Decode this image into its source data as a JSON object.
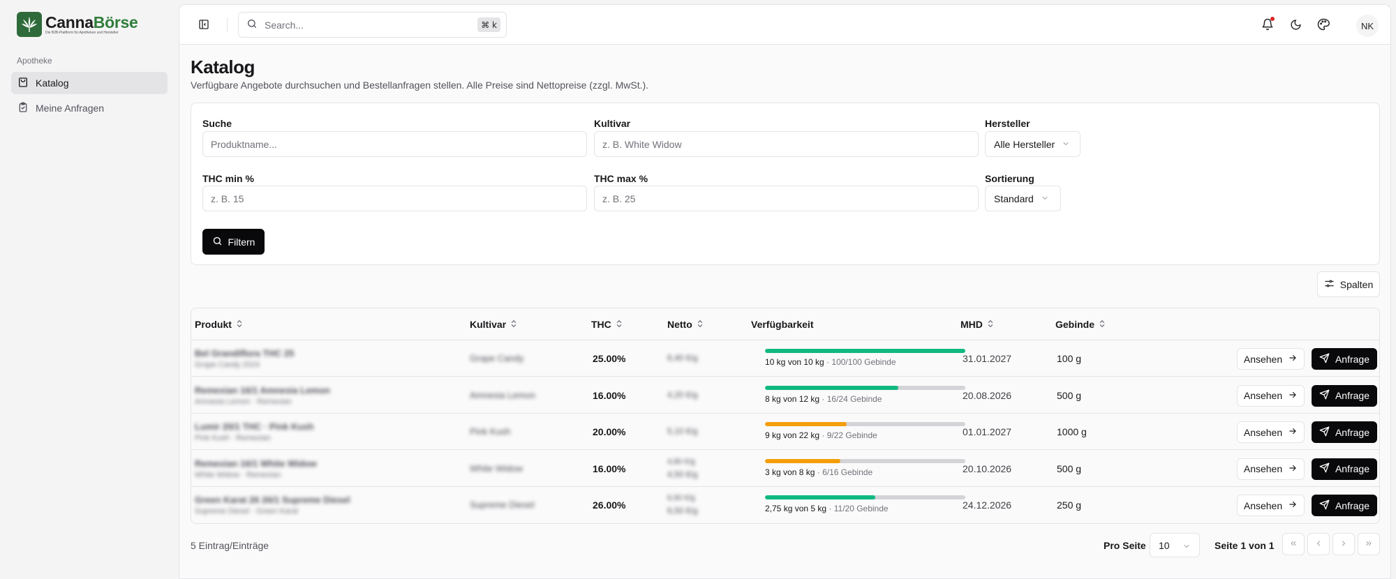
{
  "brand": {
    "name_part1": "Canna",
    "name_part2": "Börse",
    "tagline": "Die B2B-Plattform für Apotheken und Hersteller",
    "colors": {
      "logo_bg": "#2f6b3a",
      "accent_green": "#2f7d3a"
    }
  },
  "sidebar": {
    "section_label": "Apotheke",
    "items": [
      {
        "label": "Katalog",
        "icon": "shopping-bag-icon",
        "active": true
      },
      {
        "label": "Meine Anfragen",
        "icon": "clipboard-check-icon",
        "active": false
      }
    ]
  },
  "topbar": {
    "search_placeholder": "Search...",
    "shortcut": "⌘ k",
    "icons": [
      "sidebar-toggle-icon",
      "bell-icon",
      "moon-icon",
      "palette-icon"
    ],
    "notification_dot": true,
    "avatar_initials": "NK"
  },
  "page": {
    "title": "Katalog",
    "subtitle": "Verfügbare Angebote durchsuchen und Bestellanfragen stellen. Alle Preise sind Nettopreise (zzgl. MwSt.)."
  },
  "filters": {
    "search": {
      "label": "Suche",
      "placeholder": "Produktname..."
    },
    "cultivar": {
      "label": "Kultivar",
      "placeholder": "z. B. White Widow"
    },
    "manufacturer": {
      "label": "Hersteller",
      "value": "Alle Hersteller"
    },
    "thc_min": {
      "label": "THC min %",
      "placeholder": "z. B. 15"
    },
    "thc_max": {
      "label": "THC max %",
      "placeholder": "z. B. 25"
    },
    "sort": {
      "label": "Sortierung",
      "value": "Standard"
    },
    "filter_button": "Filtern"
  },
  "table": {
    "columns_button": "Spalten",
    "headers": {
      "product": "Produkt",
      "cultivar": "Kultivar",
      "thc": "THC",
      "net": "Netto",
      "availability": "Verfügbarkeit",
      "mhd": "MHD",
      "container": "Gebinde"
    },
    "view_label": "Ansehen",
    "request_label": "Anfrage",
    "rows": [
      {
        "product": "Bel Grandiflora THC 25",
        "product_sub": "Grape Candy 2024",
        "cultivar": "Grape Candy",
        "thc": "25.00%",
        "net_line1": "6,40 €/g",
        "net_line2": "",
        "avail_main": "10 kg von 10 kg",
        "avail_sub": "· 100/100 Gebinde",
        "avail_fraction": 1.0,
        "bar_color": "#10b981",
        "mhd": "31.01.2027",
        "container": "100 g"
      },
      {
        "product": "Remexian 16/1 Amnesia Lemon",
        "product_sub": "Amnesia Lemon · Remexian",
        "cultivar": "Amnesia Lemon",
        "thc": "16.00%",
        "net_line1": "4,20 €/g",
        "net_line2": "",
        "avail_main": "8 kg von 12 kg",
        "avail_sub": "· 16/24 Gebinde",
        "avail_fraction": 0.6667,
        "bar_color": "#10b981",
        "mhd": "20.08.2026",
        "container": "500 g"
      },
      {
        "product": "Lumir 20/1 THC · Pink Kush",
        "product_sub": "Pink Kush · Remexian",
        "cultivar": "Pink Kush",
        "thc": "20.00%",
        "net_line1": "5,10 €/g",
        "net_line2": "",
        "avail_main": "9 kg von 22 kg",
        "avail_sub": "· 9/22 Gebinde",
        "avail_fraction": 0.409,
        "bar_color": "#f59e0b",
        "mhd": "01.01.2027",
        "container": "1000 g"
      },
      {
        "product": "Remexian 16/1 White Widow",
        "product_sub": "White Widow · Remexian",
        "cultivar": "White Widow",
        "thc": "16.00%",
        "net_line1": "4,80 €/g",
        "net_line2": "4,50 €/g",
        "avail_main": "3 kg von 8 kg",
        "avail_sub": "· 6/16 Gebinde",
        "avail_fraction": 0.375,
        "bar_color": "#f59e0b",
        "mhd": "20.10.2026",
        "container": "500 g"
      },
      {
        "product": "Green Karat 26 26/1 Supreme Diesel",
        "product_sub": "Supreme Diesel · Green Karat",
        "cultivar": "Supreme Diesel",
        "thc": "26.00%",
        "net_line1": "6,90 €/g",
        "net_line2": "6,50 €/g",
        "avail_main": "2,75 kg von 5 kg",
        "avail_sub": "· 11/20 Gebinde",
        "avail_fraction": 0.55,
        "bar_color": "#10b981",
        "mhd": "24.12.2026",
        "container": "250 g"
      }
    ]
  },
  "footer": {
    "entries": "5 Eintrag/Einträge",
    "per_page_label": "Pro Seite",
    "per_page_value": "10",
    "page_info": "Seite 1 von 1"
  }
}
